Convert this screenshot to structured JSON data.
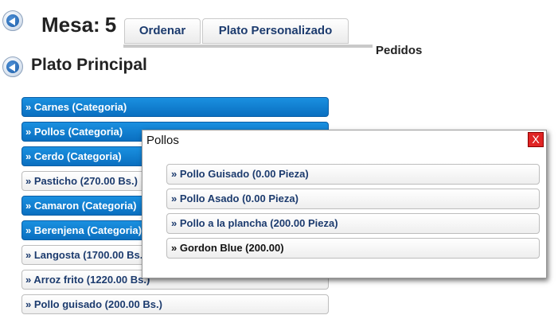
{
  "header": {
    "title_label": "Mesa:",
    "table_number": "5",
    "ordenar_button": "Ordenar",
    "plato_personalizado_button": "Plato Personalizado",
    "pedidos_label": "Pedidos"
  },
  "section": {
    "title": "Plato Principal"
  },
  "menu_items": [
    {
      "label": "» Carnes (Categoria)",
      "kind": "category"
    },
    {
      "label": "» Pollos (Categoria)",
      "kind": "category"
    },
    {
      "label": "» Cerdo (Categoria)",
      "kind": "category"
    },
    {
      "label": "» Pasticho (270.00 Bs.)",
      "kind": "dish"
    },
    {
      "label": "» Camaron (Categoria)",
      "kind": "category"
    },
    {
      "label": "» Berenjena (Categoria)",
      "kind": "category"
    },
    {
      "label": "» Langosta (1700.00 Bs.)",
      "kind": "dish"
    },
    {
      "label": "» Arroz frito (1220.00 Bs.)",
      "kind": "dish"
    },
    {
      "label": "» Pollo guisado (200.00 Bs.)",
      "kind": "dish"
    }
  ],
  "popup": {
    "title": "Pollos",
    "close_label": "X",
    "items": [
      {
        "label": "» Pollo Guisado (0.00 Pieza)"
      },
      {
        "label": "» Pollo Asado (0.00 Pieza)"
      },
      {
        "label": "» Pollo a la plancha (200.00 Pieza)"
      },
      {
        "label": "» Gordon Blue (200.00)"
      }
    ]
  },
  "colors": {
    "category_blue": "#0a6fc0",
    "link_text": "#1c3b6e",
    "close_red": "#e02424"
  }
}
